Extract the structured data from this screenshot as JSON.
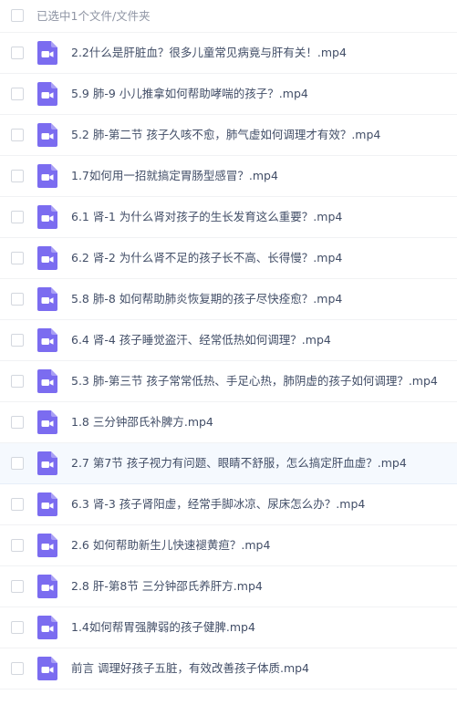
{
  "header": {
    "selection_label": "已选中1个文件/文件夹"
  },
  "colors": {
    "video_icon": "#7b6cf0",
    "highlight_row": "#f5f9fe"
  },
  "files": [
    {
      "name": "2.2什么是肝脏血？很多儿童常见病竟与肝有关！.mp4",
      "icon": "video-file-icon",
      "highlighted": false
    },
    {
      "name": "5.9 肺-9 小儿推拿如何帮助哮喘的孩子？.mp4",
      "icon": "video-file-icon",
      "highlighted": false
    },
    {
      "name": "5.2 肺-第二节 孩子久咳不愈，肺气虚如何调理才有效？.mp4",
      "icon": "video-file-icon",
      "highlighted": false
    },
    {
      "name": "1.7如何用一招就搞定胃肠型感冒？.mp4",
      "icon": "video-file-icon",
      "highlighted": false
    },
    {
      "name": "6.1 肾-1 为什么肾对孩子的生长发育这么重要？.mp4",
      "icon": "video-file-icon",
      "highlighted": false
    },
    {
      "name": "6.2 肾-2 为什么肾不足的孩子长不高、长得慢？.mp4",
      "icon": "video-file-icon",
      "highlighted": false
    },
    {
      "name": "5.8 肺-8 如何帮助肺炎恢复期的孩子尽快痊愈？.mp4",
      "icon": "video-file-icon",
      "highlighted": false
    },
    {
      "name": "6.4 肾-4 孩子睡觉盗汗、经常低热如何调理？.mp4",
      "icon": "video-file-icon",
      "highlighted": false
    },
    {
      "name": "5.3 肺-第三节 孩子常常低热、手足心热，肺阴虚的孩子如何调理？.mp4",
      "icon": "video-file-icon",
      "highlighted": false
    },
    {
      "name": "1.8 三分钟邵氏补脾方.mp4",
      "icon": "video-file-icon",
      "highlighted": false
    },
    {
      "name": "2.7 第7节 孩子视力有问题、眼睛不舒服，怎么搞定肝血虚？.mp4",
      "icon": "video-file-icon",
      "highlighted": true
    },
    {
      "name": "6.3 肾-3 孩子肾阳虚，经常手脚冰凉、尿床怎么办？.mp4",
      "icon": "video-file-icon",
      "highlighted": false
    },
    {
      "name": "2.6 如何帮助新生儿快速褪黄疸？.mp4",
      "icon": "video-file-icon",
      "highlighted": false
    },
    {
      "name": "2.8 肝-第8节 三分钟邵氏养肝方.mp4",
      "icon": "video-file-icon",
      "highlighted": false
    },
    {
      "name": "1.4如何帮胃强脾弱的孩子健脾.mp4",
      "icon": "video-file-icon",
      "highlighted": false
    },
    {
      "name": "前言 调理好孩子五脏，有效改善孩子体质.mp4",
      "icon": "video-file-icon",
      "highlighted": false
    }
  ]
}
